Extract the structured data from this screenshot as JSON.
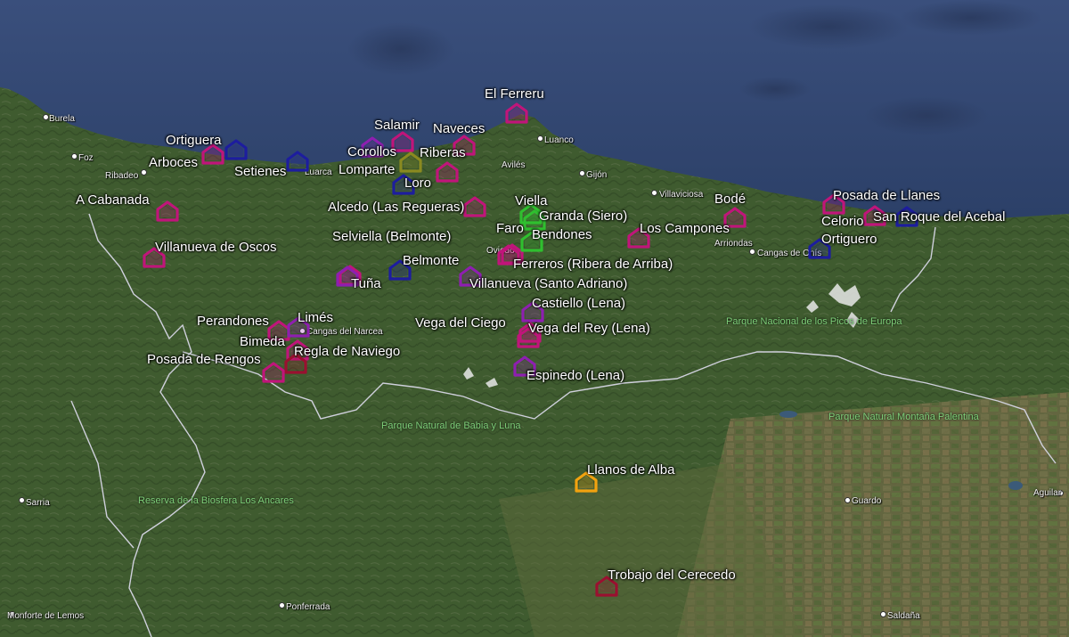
{
  "colors": {
    "sea": "#2f4570",
    "land": "#3d5a2e",
    "mountain": "#5b6a4a",
    "border": "#c9c9d6",
    "pin_magenta": "#c0157a",
    "pin_purple": "#8e1fb0",
    "pin_blue": "#1d1d9e",
    "pin_crimson": "#9a1030",
    "pin_green": "#2fbf2f",
    "pin_orange": "#f2a20f",
    "pin_olive": "#8a8a20"
  },
  "places": [
    {
      "name": "El Ferreru",
      "color": "#c0157a"
    },
    {
      "name": "Salamir",
      "color": "#c0157a"
    },
    {
      "name": "Naveces",
      "color": "#c0157a"
    },
    {
      "name": "Ortiguera",
      "color": "#1d1d9e"
    },
    {
      "name": "Corollos",
      "color": "#8e1fb0"
    },
    {
      "name": "Riberas",
      "color": "#c0157a"
    },
    {
      "name": "Arboces",
      "color": "#c0157a"
    },
    {
      "name": "Setienes",
      "color": "#1d1d9e"
    },
    {
      "name": "Lomparte",
      "color": "#8a8a20"
    },
    {
      "name": "Loro",
      "color": "#1d1d9e"
    },
    {
      "name": "A Cabanada",
      "color": "#c0157a"
    },
    {
      "name": "Alcedo (Las Regueras)",
      "color": "#c0157a"
    },
    {
      "name": "Viella",
      "color": "#2fbf2f"
    },
    {
      "name": "Granda (Siero)",
      "color": "#2fbf2f"
    },
    {
      "name": "Faro",
      "color": "#c0157a"
    },
    {
      "name": "Bendones",
      "color": "#2fbf2f"
    },
    {
      "name": "Bodé",
      "color": "#c0157a"
    },
    {
      "name": "Los Campones",
      "color": "#c0157a"
    },
    {
      "name": "Posada de Llanes",
      "color": "#c0157a"
    },
    {
      "name": "Celorio",
      "color": "#c0157a"
    },
    {
      "name": "San Roque del Acebal",
      "color": "#1d1d9e"
    },
    {
      "name": "Ortiguero",
      "color": "#1d1d9e"
    },
    {
      "name": "Villanueva de Oscos",
      "color": "#c0157a"
    },
    {
      "name": "Selviella (Belmonte)",
      "color": "#c0157a"
    },
    {
      "name": "Belmonte",
      "color": "#1d1d9e"
    },
    {
      "name": "Tuña",
      "color": "#8e1fb0"
    },
    {
      "name": "Ferreros (Ribera de Arriba)",
      "color": "#c0157a"
    },
    {
      "name": "Villanueva (Santo Adriano)",
      "color": "#8e1fb0"
    },
    {
      "name": "Castiello (Lena)",
      "color": "#8e1fb0"
    },
    {
      "name": "Perandones",
      "color": "#c0157a"
    },
    {
      "name": "Limés",
      "color": "#8e1fb0"
    },
    {
      "name": "Vega del Ciego",
      "color": "#c0157a"
    },
    {
      "name": "Vega del Rey (Lena)",
      "color": "#c0157a"
    },
    {
      "name": "Bimeda",
      "color": "#c0157a"
    },
    {
      "name": "Regla de Naviego",
      "color": "#9a1030"
    },
    {
      "name": "Posada de Rengos",
      "color": "#c0157a"
    },
    {
      "name": "Espinedo (Lena)",
      "color": "#8e1fb0"
    },
    {
      "name": "Llanos de Alba",
      "color": "#f2a20f"
    },
    {
      "name": "Trobajo del Cerecedo",
      "color": "#9a1030"
    }
  ],
  "towns": [
    "Burela",
    "Foz",
    "Ribadeo",
    "Luarca",
    "Avilés",
    "Luanco",
    "Gijón",
    "Villaviciosa",
    "Oviedo",
    "Arriondas",
    "Cangas de Onís",
    "Cangas del Narcea",
    "Sarria",
    "Monforte de Lemos",
    "Ponferrada",
    "Guardo",
    "Aguilar",
    "Saldaña"
  ],
  "parks": [
    "Parque Nacional de los Picos de Europa",
    "Parque Natural Montaña Palentina",
    "Parque Natural de Babia y Luna",
    "Reserva de la Biosfera Los Ancares"
  ]
}
